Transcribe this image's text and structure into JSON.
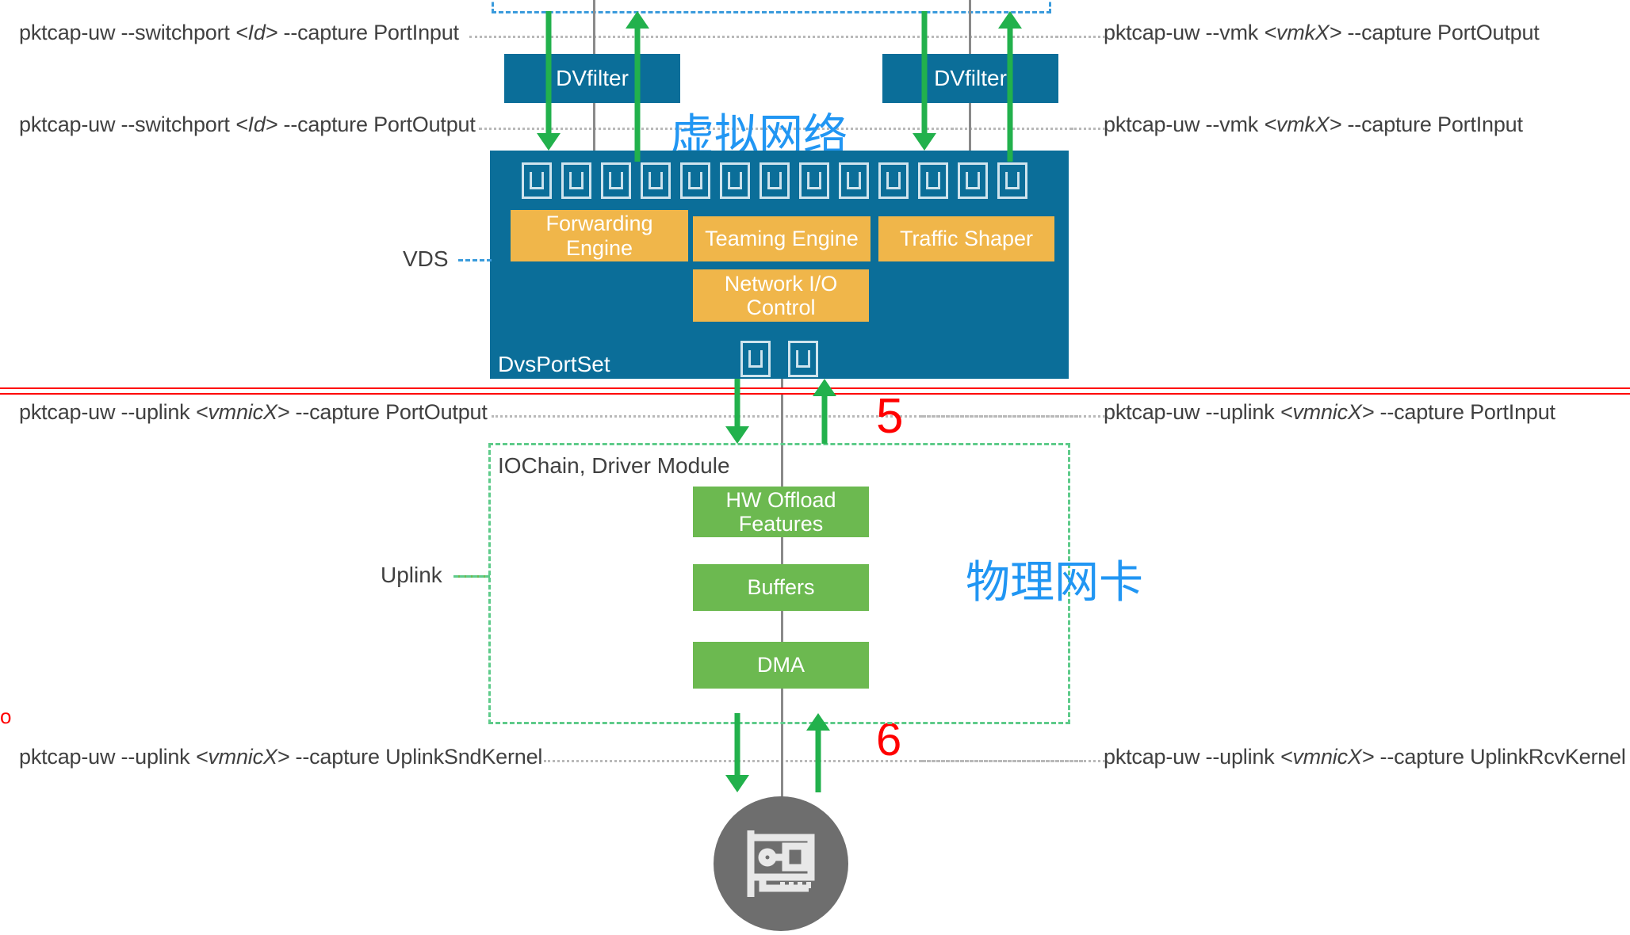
{
  "diagram": {
    "title_note": "ESXi packet capture points (pktcap-uw) across virtual network and physical NIC",
    "annotations_cn": {
      "virtual_network": "虚拟网络",
      "physical_nic": "物理网卡"
    },
    "red_markers": [
      "5",
      "6"
    ],
    "colors": {
      "vds_blue": "#0b6e99",
      "engine_orange": "#f0b64a",
      "driver_green": "#6cb950",
      "arrow_green": "#22b14c",
      "annotation_blue": "#2196f3",
      "marker_red": "#ff0000",
      "nic_gray": "#6e6e6e"
    }
  },
  "commands": {
    "left": [
      {
        "id": "switchport-portinput",
        "text": "pktcap-uw --switchport ",
        "arg": "<Id>",
        "tail": " --capture PortInput"
      },
      {
        "id": "switchport-portoutput",
        "text": "pktcap-uw --switchport ",
        "arg": "<Id>",
        "tail": " --capture PortOutput"
      },
      {
        "id": "uplink-portoutput",
        "text": "pktcap-uw --uplink ",
        "arg": "<vmnicX>",
        "tail": " --capture PortOutput"
      },
      {
        "id": "uplink-uplinksndkernel",
        "text": "pktcap-uw --uplink ",
        "arg": "<vmnicX>",
        "tail": " --capture UplinkSndKernel"
      }
    ],
    "right": [
      {
        "id": "vmk-portoutput",
        "text": "pktcap-uw --vmk ",
        "arg": "<vmkX>",
        "tail": " --capture PortOutput"
      },
      {
        "id": "vmk-portinput",
        "text": "pktcap-uw --vmk ",
        "arg": "<vmkX>",
        "tail": " --capture PortInput"
      },
      {
        "id": "uplink-portinput",
        "text": "pktcap-uw --uplink ",
        "arg": "<vmnicX>",
        "tail": " --capture PortInput"
      },
      {
        "id": "uplink-uplinkrcvkernel",
        "text": "pktcap-uw --uplink ",
        "arg": "<vmnicX>",
        "tail": " --capture UplinkRcvKernel"
      }
    ]
  },
  "labels": {
    "vds": "VDS",
    "uplink": "Uplink",
    "dvsportset": "DvsPortSet",
    "iochain": "IOChain, Driver Module",
    "dvfilter_left": "DVfilter",
    "dvfilter_right": "DVfilter"
  },
  "vds_modules": [
    {
      "id": "forwarding-engine",
      "label": "Forwarding\nEngine"
    },
    {
      "id": "teaming-engine",
      "label": "Teaming Engine"
    },
    {
      "id": "traffic-shaper",
      "label": "Traffic Shaper"
    },
    {
      "id": "network-io-control",
      "label": "Network I/O\nControl"
    }
  ],
  "driver_modules": [
    {
      "id": "hw-offload-features",
      "label": "HW Offload\nFeatures"
    },
    {
      "id": "buffers",
      "label": "Buffers"
    },
    {
      "id": "dma",
      "label": "DMA"
    }
  ],
  "ports": {
    "top_row_count": 13,
    "uplink_row_count": 2
  }
}
